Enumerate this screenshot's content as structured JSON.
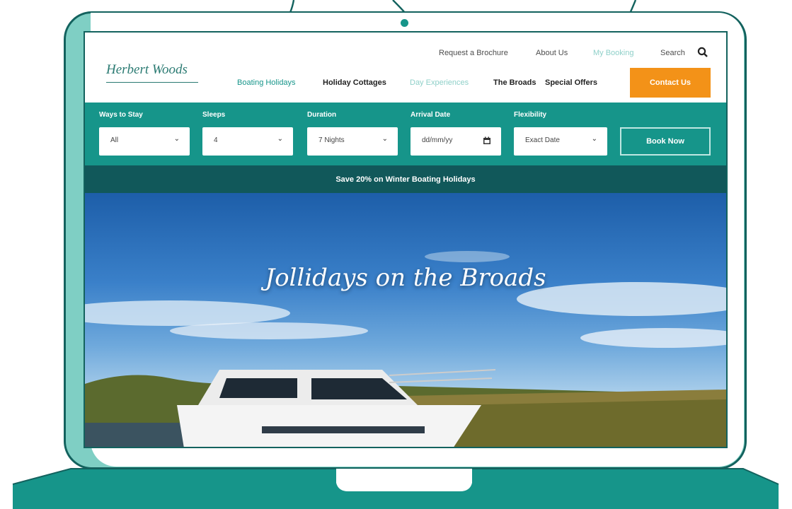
{
  "header": {
    "logo_text": "Herbert Woods",
    "top_links": [
      "Request a Brochure",
      "About Us",
      "My Booking",
      "Search"
    ],
    "main_nav": [
      "Boating Holidays",
      "Holiday Cottages",
      "Day Experiences",
      "The Broads",
      "Special Offers"
    ],
    "contact_label": "Contact Us"
  },
  "booking": {
    "fields": [
      {
        "label": "Ways to Stay",
        "value": "All"
      },
      {
        "label": "Sleeps",
        "value": "4"
      },
      {
        "label": "Duration",
        "value": "7 Nights"
      },
      {
        "label": "Arrival Date",
        "value": "dd/mm/yy"
      },
      {
        "label": "Flexibility",
        "value": "Exact Date"
      }
    ],
    "book_label": "Book Now"
  },
  "promo": "Save 20% on Winter Boating Holidays",
  "hero": {
    "title": "Jollidays on the Broads"
  },
  "colors": {
    "teal": "#16958a",
    "dark_teal": "#11585a",
    "orange": "#f39218",
    "laptop_teal": "#7fcfc4"
  },
  "icons": [
    "search-icon",
    "calendar-icon",
    "chevron-down-icon",
    "arrow-icon"
  ]
}
